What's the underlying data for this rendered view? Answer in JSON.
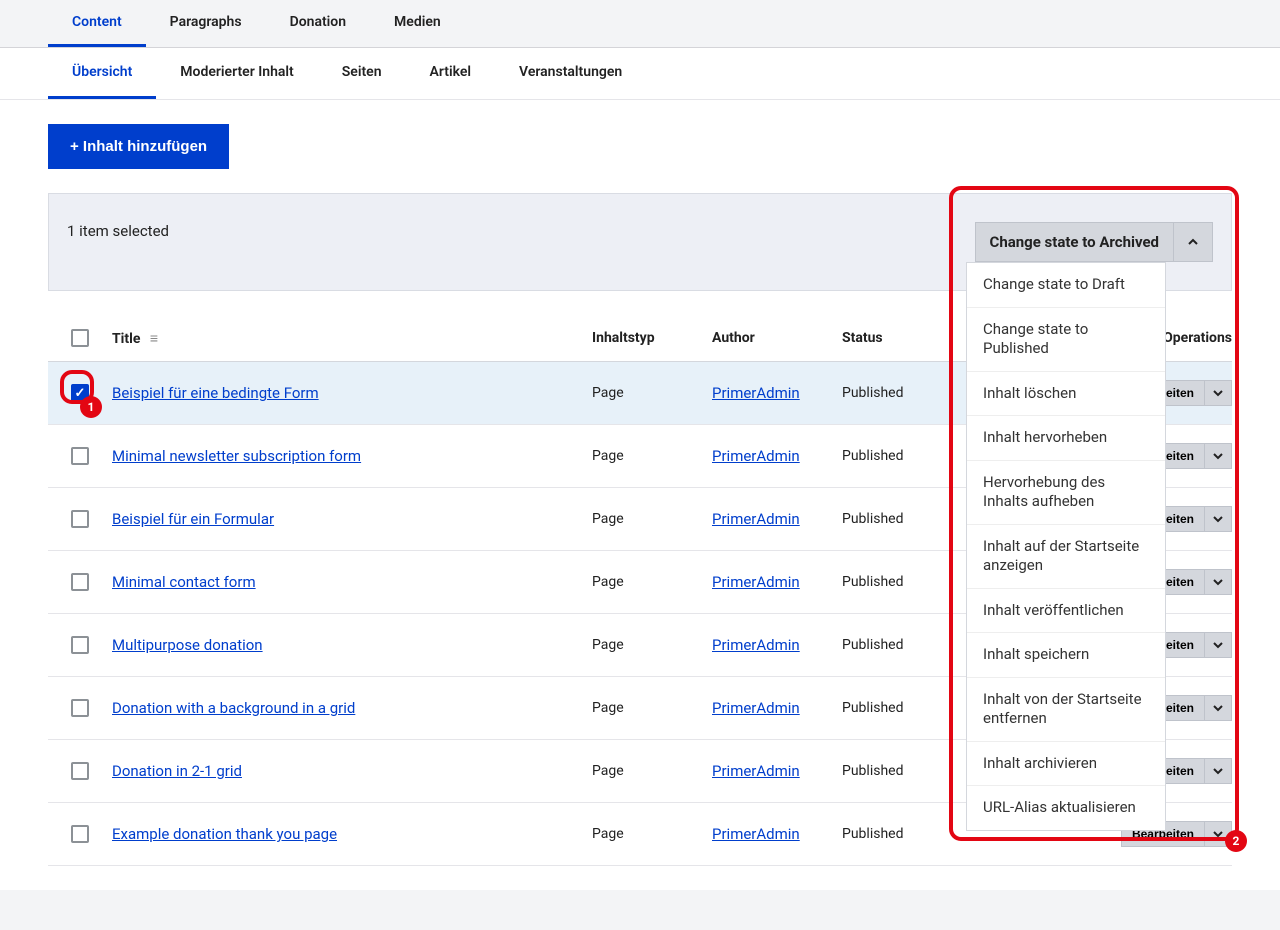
{
  "primary_tabs": [
    "Content",
    "Paragraphs",
    "Donation",
    "Medien"
  ],
  "primary_active": 0,
  "secondary_tabs": [
    "Übersicht",
    "Moderierter Inhalt",
    "Seiten",
    "Artikel",
    "Veranstaltungen"
  ],
  "secondary_active": 0,
  "add_button": "+ Inhalt hinzufügen",
  "selection_text": "1 item selected",
  "bulk_action_label": "Change state to Archived",
  "bulk_actions": [
    "Change state to Draft",
    "Change state to Published",
    "Inhalt löschen",
    "Inhalt hervorheben",
    "Hervorhebung des Inhalts aufheben",
    "Inhalt auf der Startseite anzeigen",
    "Inhalt veröffentlichen",
    "Inhalt speichern",
    "Inhalt von der Startseite entfernen",
    "Inhalt archivieren",
    "URL-Alias aktualisieren"
  ],
  "columns": {
    "title": "Title",
    "type": "Inhaltstyp",
    "author": "Author",
    "status": "Status",
    "operations": "Operations"
  },
  "op_label": "Bearbeiten",
  "rows": [
    {
      "checked": true,
      "title": "Beispiel für eine bedingte Form",
      "type": "Page",
      "author": "PrimerAdmin",
      "status": "Published"
    },
    {
      "checked": false,
      "title": "Minimal newsletter subscription form",
      "type": "Page",
      "author": "PrimerAdmin",
      "status": "Published"
    },
    {
      "checked": false,
      "title": "Beispiel für ein Formular",
      "type": "Page",
      "author": "PrimerAdmin",
      "status": "Published"
    },
    {
      "checked": false,
      "title": "Minimal contact form",
      "type": "Page",
      "author": "PrimerAdmin",
      "status": "Published"
    },
    {
      "checked": false,
      "title": "Multipurpose donation",
      "type": "Page",
      "author": "PrimerAdmin",
      "status": "Published"
    },
    {
      "checked": false,
      "title": "Donation with a background in a grid",
      "type": "Page",
      "author": "PrimerAdmin",
      "status": "Published"
    },
    {
      "checked": false,
      "title": "Donation in 2-1 grid",
      "type": "Page",
      "author": "PrimerAdmin",
      "status": "Published"
    },
    {
      "checked": false,
      "title": "Example donation thank you page",
      "type": "Page",
      "author": "PrimerAdmin",
      "status": "Published"
    }
  ],
  "annotations": {
    "badge1": "1",
    "badge2": "2"
  }
}
